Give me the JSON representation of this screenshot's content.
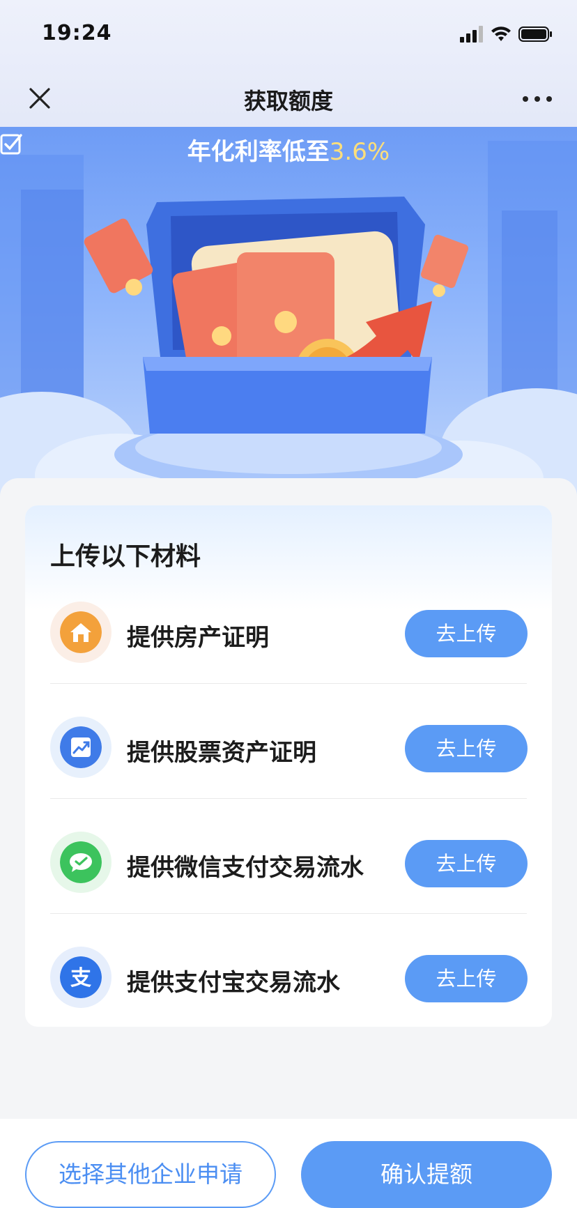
{
  "status_bar": {
    "time": "19:24"
  },
  "nav": {
    "title": "获取额度",
    "close_icon": "close-icon",
    "more_icon": "more-icon"
  },
  "banner": {
    "rate_prefix": "年化利率低至",
    "rate_value": "3.6%",
    "rate_color": "#ffdf7a"
  },
  "card": {
    "title": "上传以下材料",
    "items": [
      {
        "label": "提供房产证明",
        "button": "去上传",
        "icon": "house-icon"
      },
      {
        "label": "提供股票资产证明",
        "button": "去上传",
        "icon": "stock-chart-icon"
      },
      {
        "label": "提供微信支付交易流水",
        "button": "去上传",
        "icon": "wechat-pay-icon"
      },
      {
        "label": "提供支付宝交易流水",
        "button": "去上传",
        "icon": "alipay-icon"
      }
    ]
  },
  "footer": {
    "other_label": "选择其他企业申请",
    "confirm_label": "确认提额"
  },
  "colors": {
    "accent": "#5b9bf5",
    "accent_text": "#4b8ef2"
  }
}
